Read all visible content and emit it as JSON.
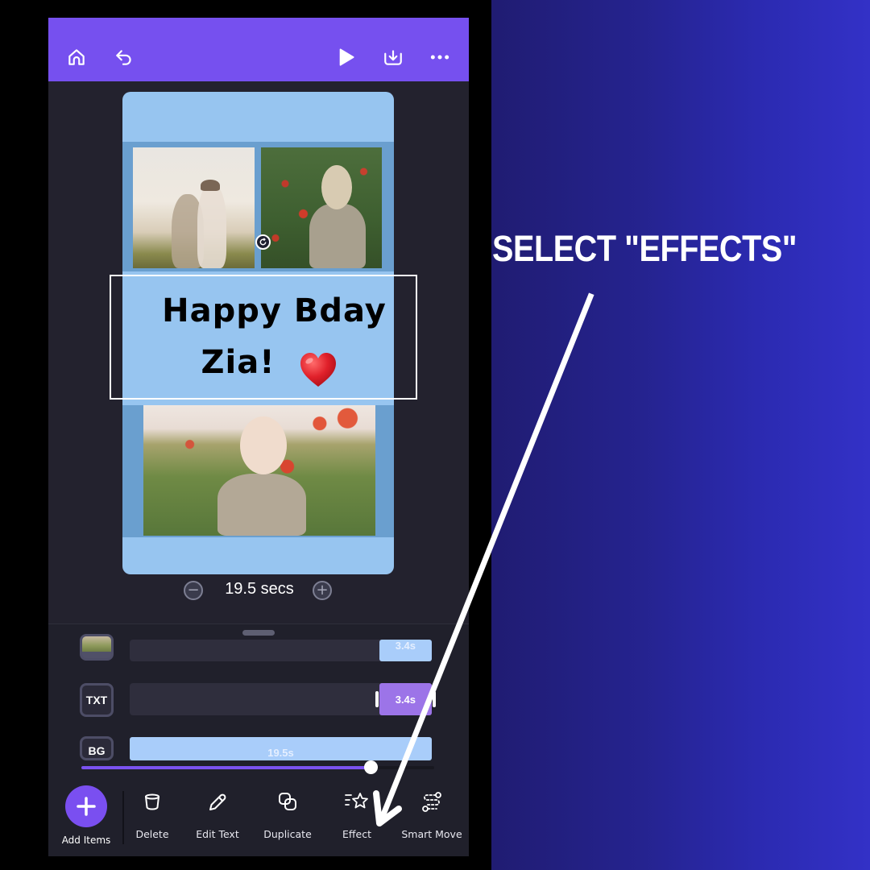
{
  "instruction": {
    "title": "SELECT \"EFFECTS\"",
    "arrow_target": "effect-tool"
  },
  "app": {
    "colors": {
      "brand_purple": "#7650ef",
      "bg_dark": "#23222e",
      "card_blue": "#97c5f0",
      "clip_blue": "#a9cdfa",
      "clip_purple": "#9c74e8"
    },
    "topbar": {
      "icons": [
        "home-icon",
        "undo-icon",
        "play-icon",
        "download-icon",
        "more-icon"
      ]
    },
    "canvas": {
      "text_line_1": "Happy Bday",
      "text_line_2": "Zia!",
      "emoji": "heart",
      "photos": [
        "mother-holding-baby-in-field",
        "girl-in-poppy-field-from-behind",
        "toddler-holding-poppy"
      ]
    },
    "duration": {
      "label": "19.5 secs",
      "minus": "−",
      "plus": "+"
    },
    "timeline": {
      "tracks": [
        {
          "chip": "",
          "type": "image",
          "clip_label": "3.4s",
          "clip_start": 0.826,
          "clip_end": 1.0
        },
        {
          "chip": "TXT",
          "type": "text",
          "clip_label": "3.4s",
          "clip_start": 0.826,
          "clip_end": 1.0,
          "selected": true
        },
        {
          "chip": "BG",
          "type": "background",
          "clip_label": "19.5s",
          "clip_start": 0.0,
          "clip_end": 1.0
        }
      ],
      "playhead_progress": 0.82
    },
    "toolbar": {
      "add_label": "Add Items",
      "tools": [
        {
          "id": "delete",
          "label": "Delete",
          "icon": "trash-icon"
        },
        {
          "id": "edit-text",
          "label": "Edit Text",
          "icon": "pencil-icon"
        },
        {
          "id": "duplicate",
          "label": "Duplicate",
          "icon": "duplicate-icon"
        },
        {
          "id": "effect",
          "label": "Effect",
          "icon": "star-effect-icon"
        },
        {
          "id": "smart-move",
          "label": "Smart Move",
          "icon": "smart-move-icon"
        }
      ]
    }
  }
}
